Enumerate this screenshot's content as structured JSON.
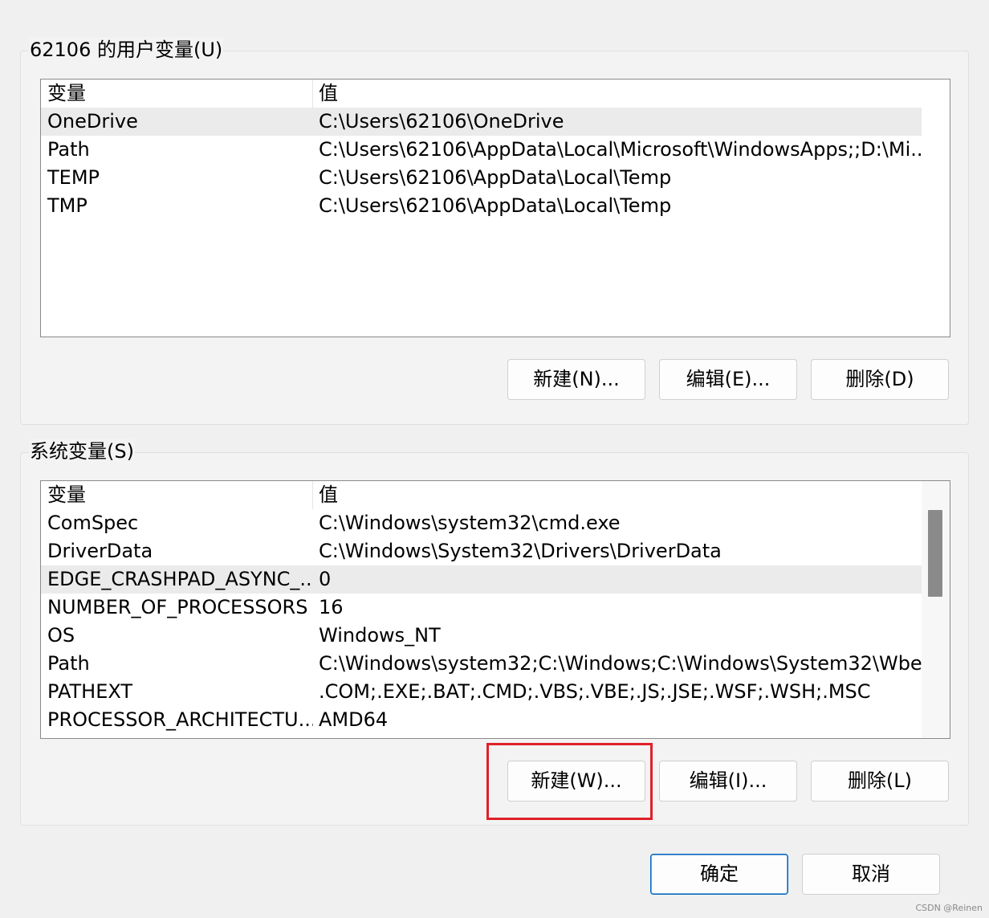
{
  "user_vars": {
    "title": "62106 的用户变量(U)",
    "col_name": "变量",
    "col_value": "值",
    "rows": [
      {
        "name": "OneDrive",
        "value": "C:\\Users\\62106\\OneDrive"
      },
      {
        "name": "Path",
        "value": "C:\\Users\\62106\\AppData\\Local\\Microsoft\\WindowsApps;;D:\\Mi..."
      },
      {
        "name": "TEMP",
        "value": "C:\\Users\\62106\\AppData\\Local\\Temp"
      },
      {
        "name": "TMP",
        "value": "C:\\Users\\62106\\AppData\\Local\\Temp"
      }
    ],
    "selected_index": 0,
    "new_label": "新建(N)...",
    "edit_label": "编辑(E)...",
    "delete_label": "删除(D)"
  },
  "system_vars": {
    "title": "系统变量(S)",
    "col_name": "变量",
    "col_value": "值",
    "rows": [
      {
        "name": "ComSpec",
        "value": "C:\\Windows\\system32\\cmd.exe"
      },
      {
        "name": "DriverData",
        "value": "C:\\Windows\\System32\\Drivers\\DriverData"
      },
      {
        "name": "EDGE_CRASHPAD_ASYNC_...",
        "value": "0"
      },
      {
        "name": "NUMBER_OF_PROCESSORS",
        "value": "16"
      },
      {
        "name": "OS",
        "value": "Windows_NT"
      },
      {
        "name": "Path",
        "value": "C:\\Windows\\system32;C:\\Windows;C:\\Windows\\System32\\Wbe..."
      },
      {
        "name": "PATHEXT",
        "value": ".COM;.EXE;.BAT;.CMD;.VBS;.VBE;.JS;.JSE;.WSF;.WSH;.MSC"
      },
      {
        "name": "PROCESSOR_ARCHITECTU...",
        "value": "AMD64"
      }
    ],
    "selected_index": 2,
    "new_label": "新建(W)...",
    "edit_label": "编辑(I)...",
    "delete_label": "删除(L)"
  },
  "dialog": {
    "ok_label": "确定",
    "cancel_label": "取消"
  },
  "watermark": "CSDN @Reinen",
  "colors": {
    "highlight": "#e0202a",
    "primary_border": "#0067c0"
  }
}
